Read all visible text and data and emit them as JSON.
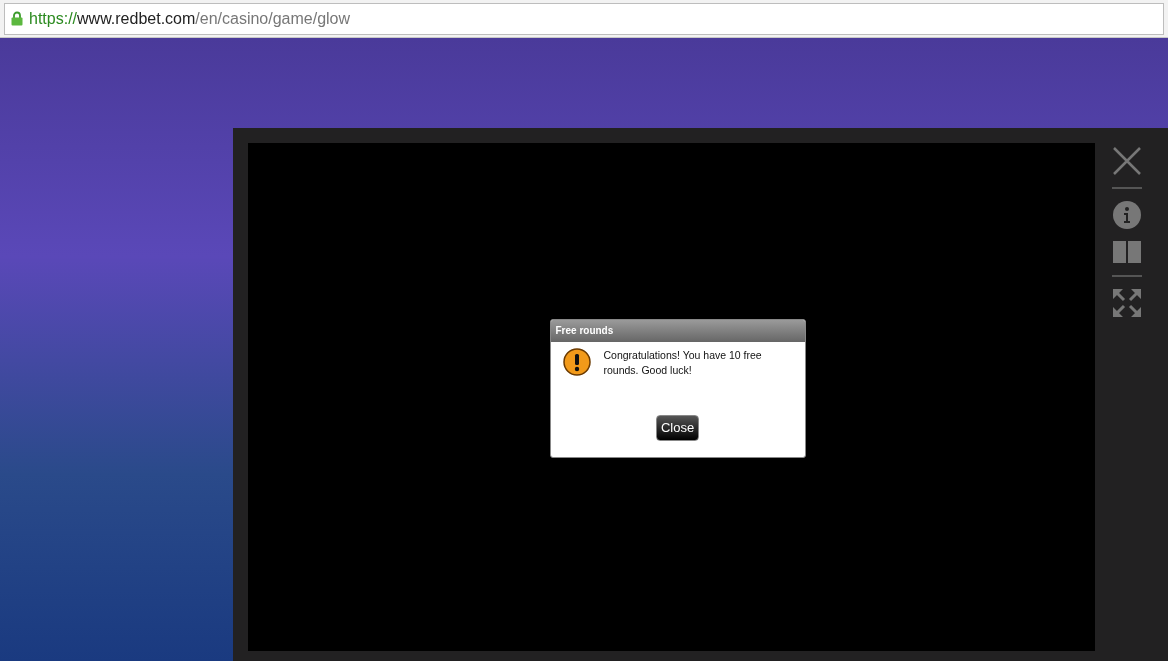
{
  "address_bar": {
    "scheme": "https://",
    "host": "www.redbet.com",
    "path": "/en/casino/game/glow"
  },
  "dialog": {
    "title": "Free rounds",
    "message": "Congratulations! You have 10 free rounds. Good luck!",
    "button": "Close"
  }
}
